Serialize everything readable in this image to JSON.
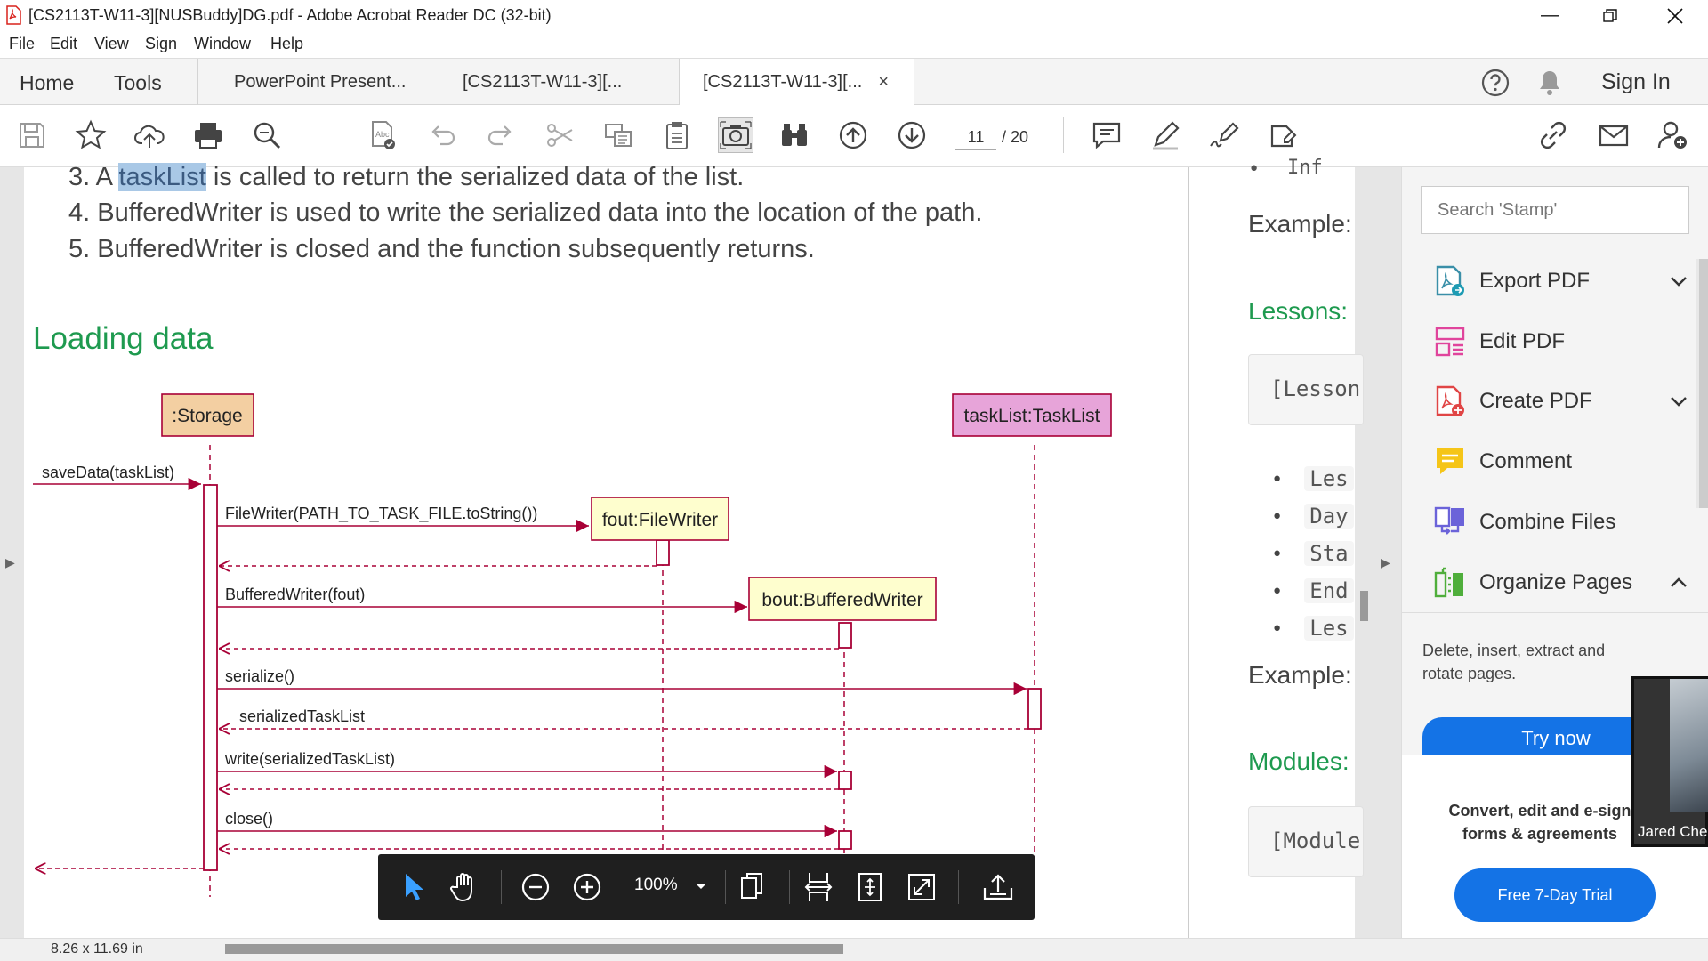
{
  "window": {
    "title": "[CS2113T-W11-3][NUSBuddy]DG.pdf - Adobe Acrobat Reader DC (32-bit)"
  },
  "menu": [
    "File",
    "Edit",
    "View",
    "Sign",
    "Window",
    "Help"
  ],
  "nav": {
    "home": "Home",
    "tools": "Tools"
  },
  "tabs": [
    {
      "label": "PowerPoint Present..."
    },
    {
      "label": "[CS2113T-W11-3][..."
    },
    {
      "label": "[CS2113T-W11-3][...",
      "close": "×"
    }
  ],
  "header_right": {
    "sign_in": "Sign In"
  },
  "pager": {
    "current": "11",
    "total": "/ 20"
  },
  "doc": {
    "line3_prefix": "3. A ",
    "line3_highlight": "taskList",
    "line3_suffix": " is called to return the serialized data of the list.",
    "line4": "4. BufferedWriter is used to write the serialized data into the location of the path.",
    "line5": "5. BufferedWriter is closed and the function subsequently returns.",
    "heading": "Loading data"
  },
  "diagram": {
    "participants": {
      "storage": ":Storage",
      "tasklist": "taskList:TaskList",
      "filewriter": "fout:FileWriter",
      "bufferedwriter": "bout:BufferedWriter"
    },
    "messages": {
      "save": "saveData(taskList)",
      "filewriter": "FileWriter(PATH_TO_TASK_FILE.toString())",
      "buffered": "BufferedWriter(fout)",
      "serialize": "serialize()",
      "serialized": "serializedTaskList",
      "write": "write(serializedTaskList)",
      "close": "close()"
    }
  },
  "page2": {
    "example1": "Example:",
    "lessons": "Lessons:",
    "code1": "[Lesson",
    "bullets": [
      "Les",
      "Day",
      "Sta",
      "End",
      "Les"
    ],
    "example2": "Example:",
    "modules": "Modules:",
    "code2": "[Module",
    "top_code": "Inf"
  },
  "rpanel": {
    "search_placeholder": "Search 'Stamp'",
    "tools": [
      {
        "label": "Export PDF",
        "icon": "export-pdf-icon"
      },
      {
        "label": "Edit PDF",
        "icon": "edit-pdf-icon"
      },
      {
        "label": "Create PDF",
        "icon": "create-pdf-icon"
      },
      {
        "label": "Comment",
        "icon": "comment-icon"
      },
      {
        "label": "Combine Files",
        "icon": "combine-files-icon"
      },
      {
        "label": "Organize Pages",
        "icon": "organize-pages-icon"
      }
    ],
    "organize_desc": "Delete, insert, extract and rotate pages.",
    "try_now": "Try now",
    "promo": "Convert, edit and e-sign forms & agreements",
    "trial": "Free 7-Day Trial",
    "video_name": "Jared Che"
  },
  "floatbar": {
    "zoom": "100%"
  },
  "status": {
    "size": "8.26 x 11.69 in"
  },
  "colors": {
    "accent": "#1473e6",
    "heading_green": "#1e9a4f",
    "seq_line": "#a80036"
  }
}
